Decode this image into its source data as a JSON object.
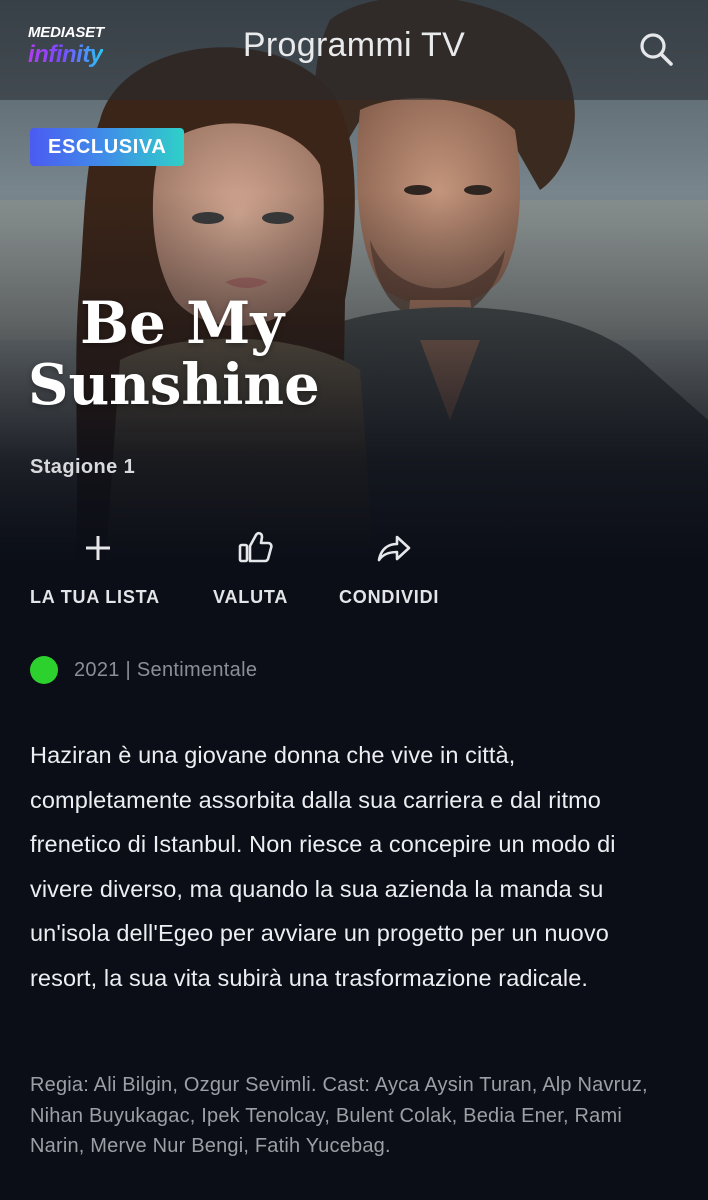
{
  "topbar": {
    "logo_top": "MEDIASET",
    "logo_bottom": "infinity",
    "title": "Programmi TV",
    "search_icon": "search-icon"
  },
  "hero": {
    "badge": "ESCLUSIVA",
    "title_line1": "Be My",
    "title_line2": "Sunshine",
    "season": "Stagione 1"
  },
  "actions": [
    {
      "label": "LA TUA LISTA",
      "icon": "plus-icon"
    },
    {
      "label": "VALUTA",
      "icon": "thumbs-up-icon"
    },
    {
      "label": "CONDIVIDI",
      "icon": "share-icon"
    }
  ],
  "meta": {
    "rating_color": "#2dd12d",
    "info": "2021 | Sentimentale"
  },
  "description": "Haziran è una giovane donna che vive in città, completamente assorbita dalla sua carriera e dal ritmo frenetico di Istanbul. Non riesce a concepire un modo di vivere diverso, ma quando la sua azienda la manda su un'isola dell'Egeo per avviare un progetto per un nuovo resort, la sua vita subirà una trasformazione radicale.",
  "credits": "Regia: Ali Bilgin, Ozgur Sevimli. Cast: Ayca Aysin Turan, Alp Navruz, Nihan Buyukagac, Ipek Tenolcay, Bulent Colak, Bedia Ener, Rami Narin, Merve Nur Bengi, Fatih Yucebag.",
  "colors": {
    "background": "#0b0e17",
    "badge_gradient_start": "#4b5bf2",
    "badge_gradient_end": "#2fd0c8"
  }
}
